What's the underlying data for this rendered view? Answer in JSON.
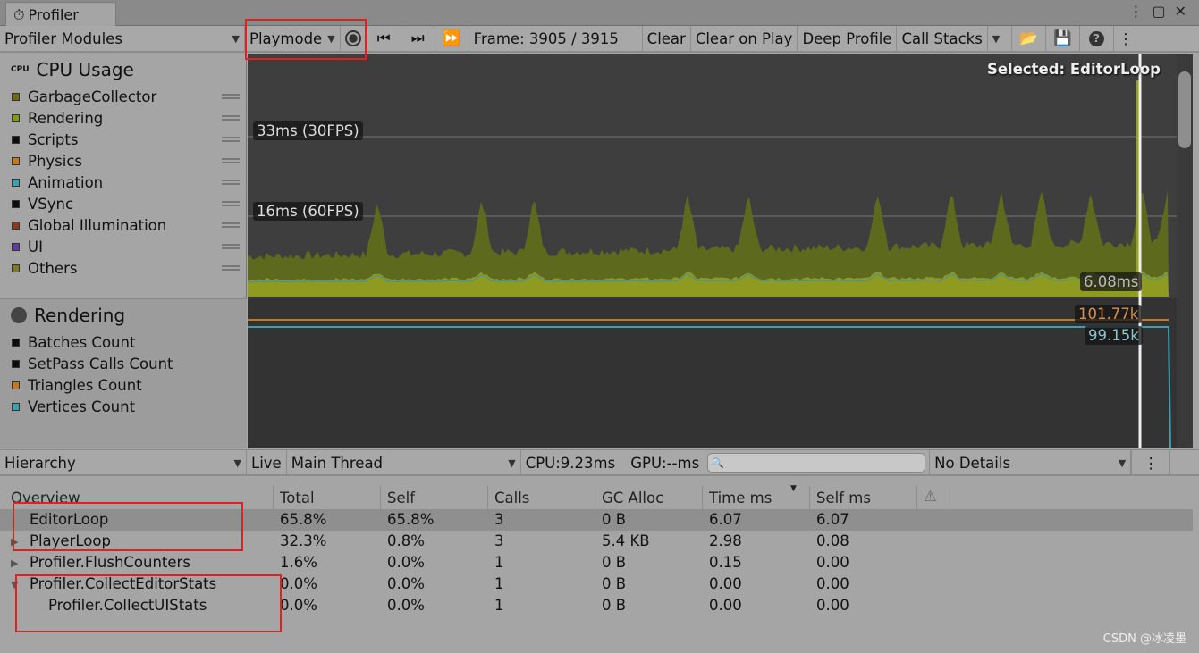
{
  "window": {
    "title": "Profiler",
    "menu_icon": "kebab-icon",
    "maximize_icon": "maximize-icon",
    "close_icon": "close-icon"
  },
  "toolbar": {
    "modules": "Profiler Modules",
    "target": "Playmode",
    "frame": "Frame: 3905 / 3915",
    "clear": "Clear",
    "clear_on_play": "Clear on Play",
    "deep_profile": "Deep Profile",
    "call_stacks": "Call Stacks"
  },
  "cpu": {
    "title": "CPU Usage",
    "legend": [
      {
        "label": "GarbageCollector",
        "color": "#6b6b14"
      },
      {
        "label": "Rendering",
        "color": "#7f9a1e"
      },
      {
        "label": "Scripts",
        "color": "#0c0c0c"
      },
      {
        "label": "Physics",
        "color": "#c37a1e"
      },
      {
        "label": "Animation",
        "color": "#3f9fae"
      },
      {
        "label": "VSync",
        "color": "#0c0c0c"
      },
      {
        "label": "Global Illumination",
        "color": "#8a3a1e"
      },
      {
        "label": "UI",
        "color": "#5f3f9e"
      },
      {
        "label": "Others",
        "color": "#7a7a2a"
      }
    ],
    "line_33": "33ms (30FPS)",
    "line_16": "16ms (60FPS)",
    "selected": "Selected: EditorLoop",
    "value": "6.08ms"
  },
  "rendering": {
    "title": "Rendering",
    "legend": [
      {
        "label": "Batches Count",
        "color": "#0c0c0c"
      },
      {
        "label": "SetPass Calls Count",
        "color": "#0c0c0c"
      },
      {
        "label": "Triangles Count",
        "color": "#c37a1e"
      },
      {
        "label": "Vertices Count",
        "color": "#3f9fae"
      }
    ],
    "triangles": "101.77k",
    "vertices": "99.15k"
  },
  "hierarchy": {
    "view": "Hierarchy",
    "live": "Live",
    "thread": "Main Thread",
    "cpu": "CPU:9.23ms",
    "gpu": "GPU:--ms",
    "search_placeholder": "",
    "details": "No Details"
  },
  "table": {
    "columns": [
      "Overview",
      "Total",
      "Self",
      "Calls",
      "GC Alloc",
      "Time ms",
      "Self ms"
    ],
    "rows": [
      {
        "name": "EditorLoop",
        "indent": 0,
        "expander": "",
        "cells": [
          "65.8%",
          "65.8%",
          "3",
          "0 B",
          "6.07",
          "6.07"
        ],
        "selected": true
      },
      {
        "name": "PlayerLoop",
        "indent": 0,
        "expander": "▶",
        "cells": [
          "32.3%",
          "0.8%",
          "3",
          "5.4 KB",
          "2.98",
          "0.08"
        ]
      },
      {
        "name": "Profiler.FlushCounters",
        "indent": 0,
        "expander": "▶",
        "cells": [
          "1.6%",
          "0.0%",
          "1",
          "0 B",
          "0.15",
          "0.00"
        ]
      },
      {
        "name": "Profiler.CollectEditorStats",
        "indent": 0,
        "expander": "▼",
        "cells": [
          "0.0%",
          "0.0%",
          "1",
          "0 B",
          "0.00",
          "0.00"
        ]
      },
      {
        "name": "Profiler.CollectUIStats",
        "indent": 1,
        "expander": "",
        "cells": [
          "0.0%",
          "0.0%",
          "1",
          "0 B",
          "0.00",
          "0.00"
        ]
      }
    ]
  },
  "watermark": "CSDN @冰凌墨"
}
